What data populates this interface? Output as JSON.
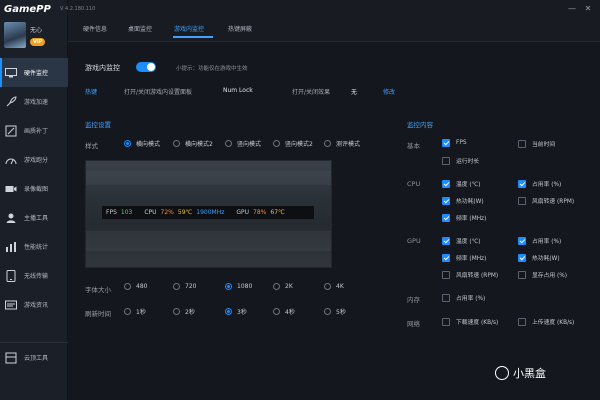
{
  "app": {
    "logo": "GamePP",
    "version": "V 4.2.180.110"
  },
  "user": {
    "name": "无心",
    "badge": "VIP"
  },
  "sidebar": {
    "items": [
      {
        "label": "硬件监控",
        "icon": "monitor-icon"
      },
      {
        "label": "游戏加速",
        "icon": "rocket-icon"
      },
      {
        "label": "画质补丁",
        "icon": "paint-icon"
      },
      {
        "label": "游戏跑分",
        "icon": "gauge-icon"
      },
      {
        "label": "录像截图",
        "icon": "camera-icon"
      },
      {
        "label": "主播工具",
        "icon": "streamer-icon"
      },
      {
        "label": "性能统计",
        "icon": "stats-icon"
      },
      {
        "label": "无线传输",
        "icon": "phone-icon"
      },
      {
        "label": "游戏资讯",
        "icon": "news-icon"
      },
      {
        "label": "云顶工具",
        "icon": "tools-icon"
      }
    ]
  },
  "tabs": [
    "硬件信息",
    "桌面监控",
    "游戏内监控",
    "热键屏蔽"
  ],
  "window": {
    "minimize": "—",
    "close": "✕"
  },
  "main": {
    "monitor_label": "游戏内监控",
    "hint": "小提示：功能仅在游戏中生效",
    "hotkey": {
      "label": "热键",
      "toggle_text": "打开/关闭游戏内设置面板",
      "toggle_value": "Num Lock",
      "effect_text": "打开/关闭效果",
      "effect_value": "无",
      "edit_label": "修改"
    },
    "settings_title": "监控设置",
    "content_title": "监控内容",
    "style_label": "样式",
    "styles": [
      "横向模式",
      "横向模式2",
      "竖向模式",
      "竖向模式2",
      "测评模式"
    ],
    "overlay": {
      "fps_label": "FPS",
      "fps_value": "103",
      "cpu_label": "CPU",
      "cpu_usage": "72%",
      "cpu_temp": "59℃",
      "cpu_clock": "1900MHz",
      "gpu_label": "GPU",
      "gpu_usage": "78%",
      "gpu_temp": "67℃"
    },
    "font_label": "字体大小",
    "font_sizes": [
      "480",
      "720",
      "1080",
      "2K",
      "4K"
    ],
    "refresh_label": "刷新时间",
    "refresh_times": [
      "1秒",
      "2秒",
      "3秒",
      "4秒",
      "5秒"
    ],
    "categories": {
      "basic": "基本",
      "cpu": "CPU",
      "gpu": "GPU",
      "memory": "内存",
      "network": "网络"
    },
    "checks": {
      "fps": "FPS",
      "current_time": "当前时间",
      "runtime": "运行时长",
      "cpu_temp": "温度 (℃)",
      "cpu_usage": "占用率 (%)",
      "cpu_power": "热功耗(W)",
      "cpu_fan": "风扇转速 (RPM)",
      "cpu_freq": "频率 (MHz)",
      "gpu_temp": "温度 (℃)",
      "gpu_usage": "占用率 (%)",
      "gpu_freq": "频率 (MHz)",
      "gpu_power": "热功耗(W)",
      "gpu_fan": "风扇转速 (RPM)",
      "gpu_vram": "显存占用 (%)",
      "mem_usage": "占用率 (%)",
      "net_down": "下载速度 (KB/s)",
      "net_up": "上传速度 (KB/s)"
    }
  },
  "watermark": "小黑盒",
  "colors": {
    "accent": "#1e8bff",
    "fps": "#4cd964",
    "usage": "#ff8c3a",
    "temp": "#f0c040",
    "clock": "#3fa2ff"
  }
}
